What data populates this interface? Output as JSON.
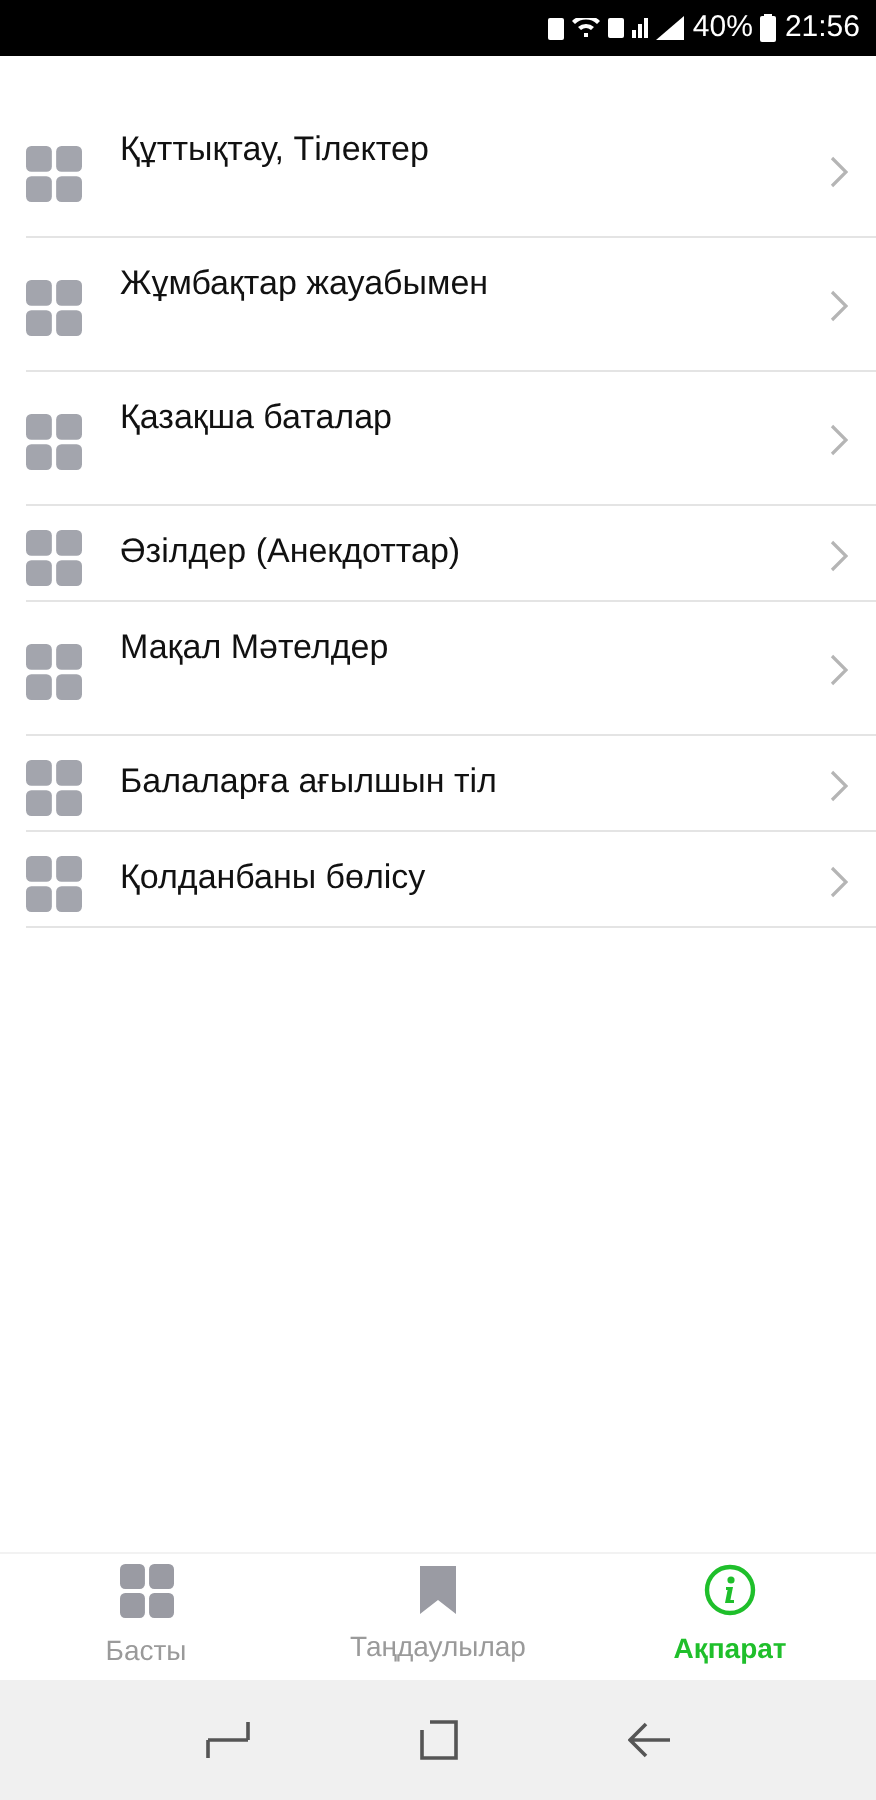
{
  "status_bar": {
    "battery": "40%",
    "time": "21:56"
  },
  "menu": [
    {
      "label": "Құттықтау, Тілектер",
      "kind": "tall"
    },
    {
      "label": "Жұмбақтар жауабымен",
      "kind": "tall"
    },
    {
      "label": "Қазақша баталар",
      "kind": "tall"
    },
    {
      "label": "Әзілдер (Анекдоттар)",
      "kind": "short"
    },
    {
      "label": "Мақал Мәтелдер",
      "kind": "tall"
    },
    {
      "label": "Балаларға ағылшын тіл",
      "kind": "short"
    },
    {
      "label": "Қолданбаны бөлісу",
      "kind": "short"
    }
  ],
  "tabs": [
    {
      "label": "Басты",
      "kind": "grid",
      "selected": false
    },
    {
      "label": "Таңдаулылар",
      "kind": "bookmark",
      "selected": false
    },
    {
      "label": "Ақпарат",
      "kind": "info",
      "selected": true
    }
  ]
}
